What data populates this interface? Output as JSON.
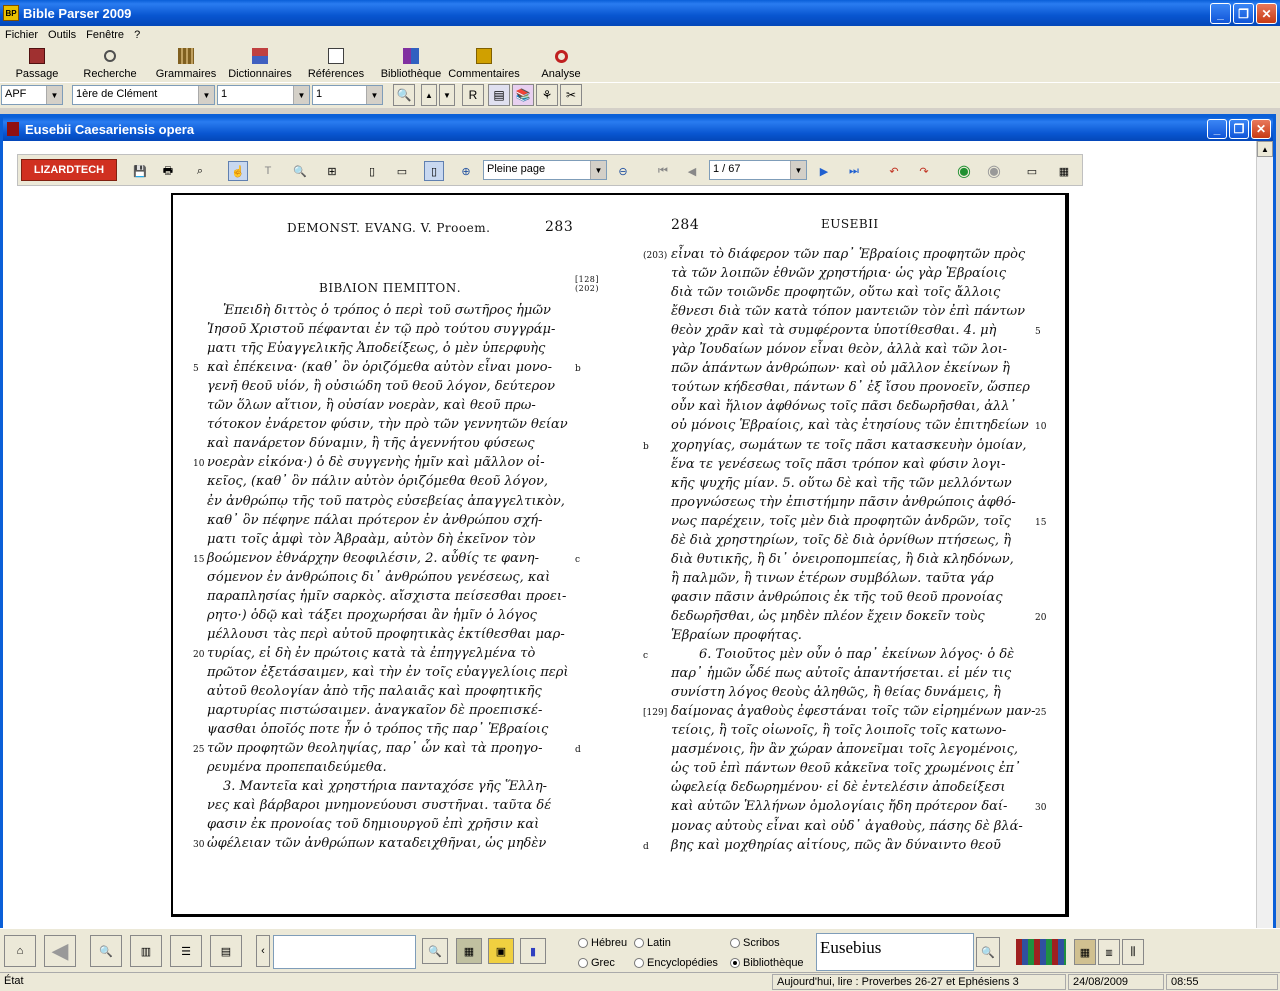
{
  "app": {
    "title": "Bible Parser 2009",
    "icon_text": "BP"
  },
  "menu": [
    "Fichier",
    "Outils",
    "Fenêtre",
    "?"
  ],
  "toolbar": [
    {
      "label": "Passage",
      "icon": "book-icon",
      "color": "#a03030"
    },
    {
      "label": "Recherche",
      "icon": "magnifier-icon",
      "color": "#606060"
    },
    {
      "label": "Grammaires",
      "icon": "books-icon",
      "color": "#806020"
    },
    {
      "label": "Dictionnaires",
      "icon": "dictionary-icon",
      "color": "#c04040"
    },
    {
      "label": "Références",
      "icon": "references-icon",
      "color": "#404040"
    },
    {
      "label": "Bibliothèque",
      "icon": "library-icon",
      "color": "#8030a0"
    },
    {
      "label": "Commentaires",
      "icon": "commentary-icon",
      "color": "#d0a000"
    },
    {
      "label": "Analyse",
      "icon": "analysis-icon",
      "color": "#c02020"
    }
  ],
  "selectors": {
    "version": "APF",
    "book": "1ère de Clément",
    "chapter": "1",
    "verse": "1",
    "r_label": "R"
  },
  "child": {
    "title": "Eusebii Caesariensis opera"
  },
  "viewer": {
    "logo": "LIZARDTECH",
    "zoom_mode": "Pleine page",
    "page_indicator": "1 / 67"
  },
  "doc": {
    "left_header": "DEMONST. EVANG. V. Prooem.",
    "left_page_num": "283",
    "right_page_num": "284",
    "right_header": "EUSEBII",
    "book_title": "ΒΙΒΛΙΟΝ ΠΕΜΠΤΟΝ.",
    "bracket_ref": "[128]\n(202)",
    "left_lines": [
      "Ἐπειδὴ διττὸς ὁ τρόπος ὁ περὶ τοῦ σωτῆρος ἡμῶν",
      "Ἰησοῦ Χριστοῦ πέφανται ἐν τῷ πρὸ τούτου συγγράμ-",
      "ματι τῆς Εὐαγγελικῆς Ἀποδείξεως, ὁ μὲν ὑπερφυὴς",
      "καὶ ἐπέκεινα· (καθ᾽ ὃν ὁριζόμεθα αὐτὸν εἶναι μονο-",
      "γενῆ θεοῦ υἱόν, ἢ οὐσιώδη τοῦ θεοῦ λόγον, δεύτερον",
      "τῶν ὅλων αἴτιον, ἢ οὐσίαν νοερὰν, καὶ θεοῦ πρω-",
      "τότοκον ἐνάρετον φύσιν, τὴν πρὸ τῶν γεννητῶν θείαν",
      "καὶ πανάρετον δύναμιν, ἢ τῆς ἀγεννήτου φύσεως",
      "νοερὰν εἰκόνα·) ὁ δὲ συγγενὴς ἡμῖν καὶ μᾶλλον οἰ-",
      "κεῖος, (καθ᾽ ὃν πάλιν αὐτὸν ὁριζόμεθα θεοῦ λόγον,",
      "ἐν ἀνθρώπῳ τῆς τοῦ πατρὸς εὐσεβείας ἀπαγγελτικὸν,",
      "καθ᾽ ὃν πέφηνε πάλαι πρότερον ἐν ἀνθρώπου σχή-",
      "ματι τοῖς ἀμφὶ τὸν Ἀβραὰμ, αὐτὸν δὴ ἐκεῖνον τὸν",
      "βοώμενον ἐθνάρχην θεοφιλέσιν, 2. αὖθίς τε φανη-",
      "σόμενον ἐν ἀνθρώποις δι᾽ ἀνθρώπου γενέσεως, καὶ",
      "παραπλησίας ἡμῖν σαρκὸς. αἴσχιστα πείσεσθαι προει-",
      "ρητο·) ὁδῷ καὶ τάξει προχωρήσαι ἂν ἡμῖν ὁ λόγος",
      "μέλλουσι τὰς περὶ αὐτοῦ προφητικὰς ἐκτίθεσθαι μαρ-",
      "τυρίας, εἰ δὴ ἐν πρώτοις κατὰ τὰ ἐπηγγελμένα τὸ",
      "πρῶτον ἐξετάσαιμεν, καὶ τὴν ἐν τοῖς εὐαγγελίοις περὶ",
      "αὐτοῦ θεολογίαν ἀπὸ τῆς παλαιᾶς καὶ προφητικῆς",
      "μαρτυρίας πιστώσαιμεν. ἀναγκαῖον δὲ προεπισκέ-",
      "ψασθαι ὁποῖός ποτε ἦν ὁ τρόπος τῆς παρ᾽ Ἑβραίοις",
      "τῶν προφητῶν θεοληψίας, παρ᾽ ὧν καὶ τὰ προηγο-",
      "ρευμένα προπεπαιδεύμεθα.",
      "3. Μαντεῖα καὶ χρηστήρια πανταχόσε γῆς Ἕλλη-",
      "νες καὶ βάρβαροι μνημονεύουσι συστῆναι. ταῦτα δέ",
      "φασιν ἐκ προνοίας τοῦ δημιουργοῦ ἐπὶ χρῆσιν καὶ",
      "ὠφέλειαν τῶν ἀνθρώπων καταδειχθῆναι, ὡς μηδὲν"
    ],
    "left_numbers": [
      "5",
      "10",
      "15",
      "20",
      "25",
      "30"
    ],
    "left_margin_letters": [
      "b",
      "c",
      "d"
    ],
    "right_lines": [
      "εἶναι τὸ διάφερον τῶν παρ᾽ Ἑβραίοις προφητῶν πρὸς",
      "τὰ τῶν λοιπῶν ἐθνῶν χρηστήρια· ὡς γὰρ Ἑβραίοις",
      "διὰ τῶν τοιῶνδε προφητῶν, οὕτω καὶ τοῖς ἄλλοις",
      "ἔθνεσι διὰ τῶν κατὰ τόπον μαντειῶν τὸν ἐπὶ πάντων",
      "θεὸν χρᾶν καὶ τὰ συμφέροντα ὑποτίθεσθαι. 4. μὴ",
      "γὰρ Ἰουδαίων μόνον εἶναι θεὸν, ἀλλὰ καὶ τῶν λοι-",
      "πῶν ἁπάντων ἀνθρώπων· καὶ οὐ μᾶλλον ἐκείνων ἢ",
      "τούτων κήδεσθαι, πάντων δ᾽ ἐξ ἴσου προνοεῖν, ὥσπερ",
      "οὖν καὶ ἥλιον ἀφθόνως τοῖς πᾶσι δεδωρῆσθαι, ἀλλ᾽",
      "οὐ μόνοις Ἑβραίοις, καὶ τὰς ἐτησίους τῶν ἐπιτηδείων",
      "χορηγίας, σωμάτων τε τοῖς πᾶσι κατασκευὴν ὁμοίαν,",
      "ἕνα τε γενέσεως τοῖς πᾶσι τρόπον καὶ φύσιν λογι-",
      "κῆς ψυχῆς μίαν. 5. οὕτω δὲ καὶ τῆς τῶν μελλόντων",
      "προγνώσεως τὴν ἐπιστήμην πᾶσιν ἀνθρώποις ἀφθό-",
      "νως παρέχειν, τοῖς μὲν διὰ προφητῶν ἀνδρῶν, τοῖς",
      "δὲ διὰ χρηστηρίων, τοῖς δὲ διὰ ὀρνίθων πτήσεως, ἢ",
      "διὰ θυτικῆς, ἢ δι᾽ ὀνειροπομπείας, ἢ διὰ κληδόνων,",
      "ἢ παλμῶν, ἢ τινων ἑτέρων συμβόλων. ταῦτα γάρ",
      "φασιν πᾶσιν ἀνθρώποις ἐκ τῆς τοῦ θεοῦ προνοίας",
      "δεδωρῆσθαι, ὡς μηδὲν πλέον ἔχειν δοκεῖν τοὺς",
      "Ἑβραίων προφήτας.",
      "6. Τοιοῦτος μὲν οὖν ὁ παρ᾽ ἐκείνων λόγος· ὁ δὲ",
      "παρ᾽ ἡμῶν ὧδέ πως αὐτοῖς ἀπαντήσεται. εἰ μέν τις",
      "συνίστη λόγος θεοὺς ἀληθῶς, ἢ θείας δυνάμεις, ἢ",
      "δαίμονας ἀγαθοὺς ἐφεστάναι τοῖς τῶν εἰρημένων μαν-",
      "τείοις, ἢ τοῖς οἰωνοῖς, ἢ τοῖς λοιποῖς τοῖς κατωνο-",
      "μασμένοις, ἣν ἂν χώραν ἀπονεῖμαι τοῖς λεγομένοις,",
      "ὡς τοῦ ἐπὶ πάντων θεοῦ κἀκεῖνα τοῖς χρωμένοις ἐπ᾽",
      "ὠφελείᾳ δεδωρημένου· εἰ δὲ ἐντελέσιν ἀποδείξεσι",
      "καὶ αὐτῶν Ἑλλήνων ὁμολογίαις ἤδη πρότερον δαί-",
      "μονας αὐτοὺς εἶναι καὶ οὐδ᾽ ἀγαθοὺς, πάσης δὲ βλά-",
      "βης καὶ μοχθηρίας αἰτίους, πῶς ἂν δύναιντο θεοῦ"
    ],
    "right_left_notes": [
      "(203)",
      "b",
      "c",
      "[129]",
      "d"
    ],
    "right_numbers": [
      "5",
      "10",
      "15",
      "20",
      "25",
      "30"
    ]
  },
  "bottom": {
    "search_value": "",
    "radios": [
      {
        "label": "Hébreu",
        "checked": false
      },
      {
        "label": "Latin",
        "checked": false
      },
      {
        "label": "Scribos",
        "checked": false
      },
      {
        "label": "Grec",
        "checked": false
      },
      {
        "label": "Encyclopédies",
        "checked": false
      },
      {
        "label": "Bibliothèque",
        "checked": true
      }
    ],
    "author_field": "Eusebius"
  },
  "status": {
    "state": "État",
    "reading": "Aujourd'hui, lire : Proverbes 26-27 et Ephésiens 3",
    "date": "24/08/2009",
    "time": "08:55"
  }
}
